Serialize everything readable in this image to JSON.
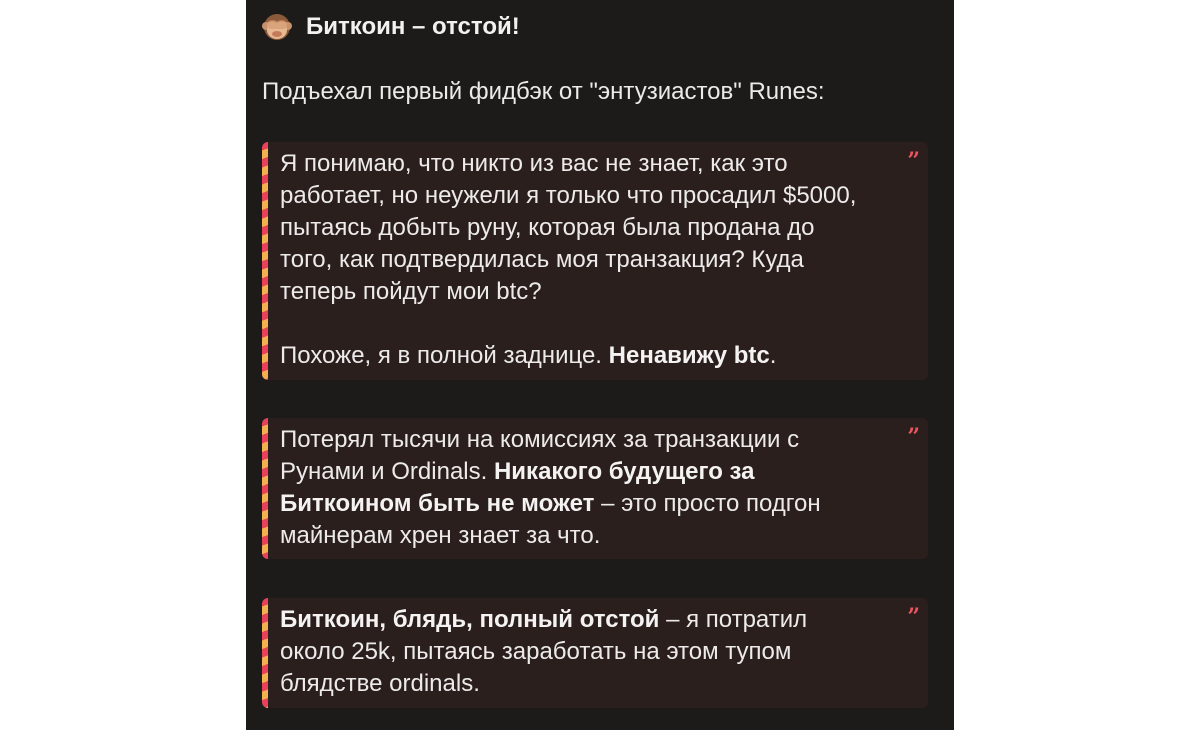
{
  "post": {
    "title": "Биткоин – отстой!",
    "emoji_icon": "see-no-evil-monkey-icon",
    "intro": "Подъехал первый фидбэк от \"энтузиастов\" Runes:",
    "quote_mark": "”",
    "quotes": [
      {
        "p1": "Я понимаю, что никто из вас не знает, как это работает, но неужели я только что просадил $5000, пытаясь добыть руну, которая была продана до того, как подтвердилась моя транзакция? Куда теперь пойдут мои btc?",
        "p2_normal": "Похоже, я в полной заднице. ",
        "p2_bold": "Ненавижу btc",
        "p2_end": "."
      },
      {
        "normal1": "Потерял тысячи на комиссиях за транзакции с Рунами и Ordinals. ",
        "bold": "Никакого будущего за Биткоином быть не может",
        "normal2": " – это просто подгон майнерам хрен знает за что."
      },
      {
        "bold": "Биткоин, блядь, полный отстой",
        "normal": " – я потратил около 25k, пытаясь заработать на этом тупом блядстве ordinals."
      }
    ],
    "colors": {
      "background": "#1c1b1a",
      "quote_background": "#2b1f1e",
      "stripe_red": "#e9415a",
      "stripe_orange": "#f3b04f",
      "quote_mark": "#e8555f",
      "text": "#ecebe9"
    }
  }
}
